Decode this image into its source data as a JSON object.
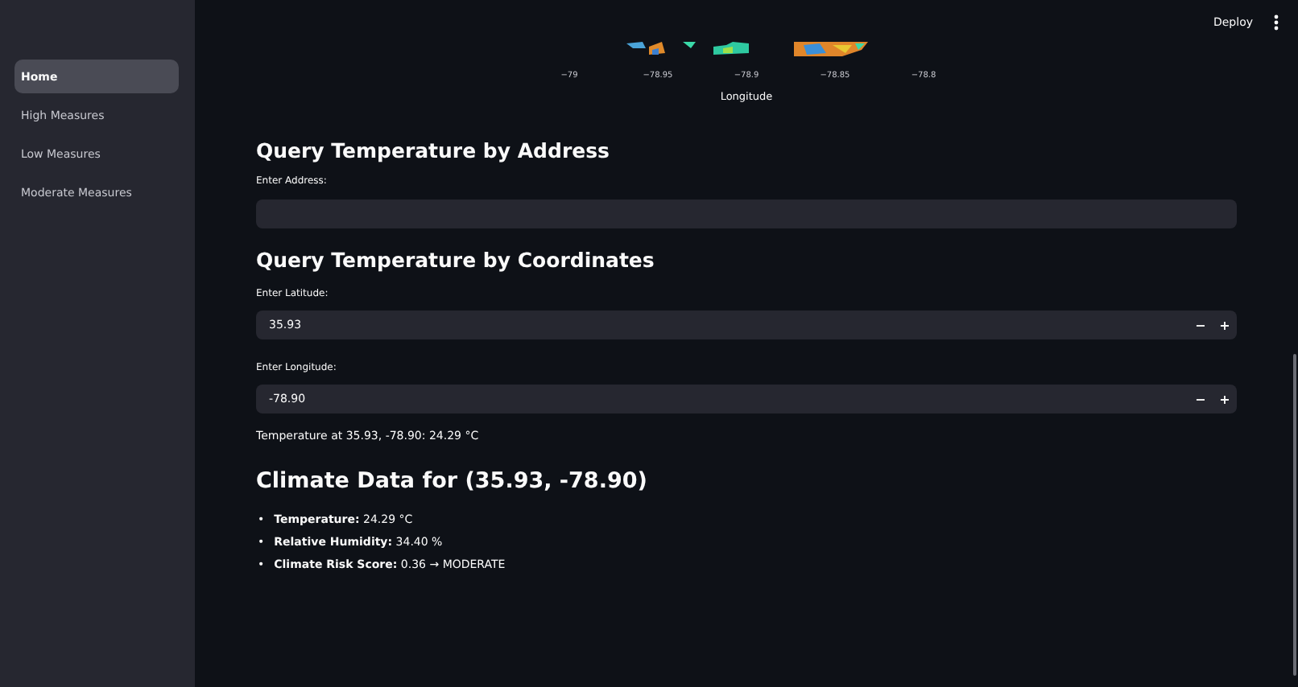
{
  "sidebar": {
    "items": [
      {
        "label": "Home",
        "selected": true
      },
      {
        "label": "High Measures",
        "selected": false
      },
      {
        "label": "Low Measures",
        "selected": false
      },
      {
        "label": "Moderate Measures",
        "selected": false
      }
    ]
  },
  "header": {
    "deploy": "Deploy"
  },
  "map_plot": {
    "kind": "picture",
    "xticks": [
      "−79",
      "−78.95",
      "−78.9",
      "−78.85",
      "−78.8"
    ],
    "xlabel": "Longitude"
  },
  "address_section": {
    "title": "Query Temperature by Address",
    "field_label": "Enter Address:"
  },
  "coordinates_section": {
    "title": "Query Temperature by Coordinates",
    "fields": [
      {
        "label": "Enter Latitude:",
        "value": "35.93",
        "minus": "−",
        "plus": "+"
      },
      {
        "label": "Enter Longitude:",
        "value": "-78.90",
        "minus": "−",
        "plus": "+"
      }
    ],
    "result": "Temperature at 35.93, -78.90: 24.29 °C"
  },
  "climate_section": {
    "title": "Climate Data for (35.93, -78.90)",
    "items": [
      {
        "bullet": "•",
        "text": "**Temperature:** 24.29 °C"
      },
      {
        "bullet": "•",
        "text": "**Relative Humidity:** 34.40 %"
      },
      {
        "bullet": "•",
        "text": "**Climate Risk Score:** 0.36 → MODERATE"
      }
    ]
  }
}
